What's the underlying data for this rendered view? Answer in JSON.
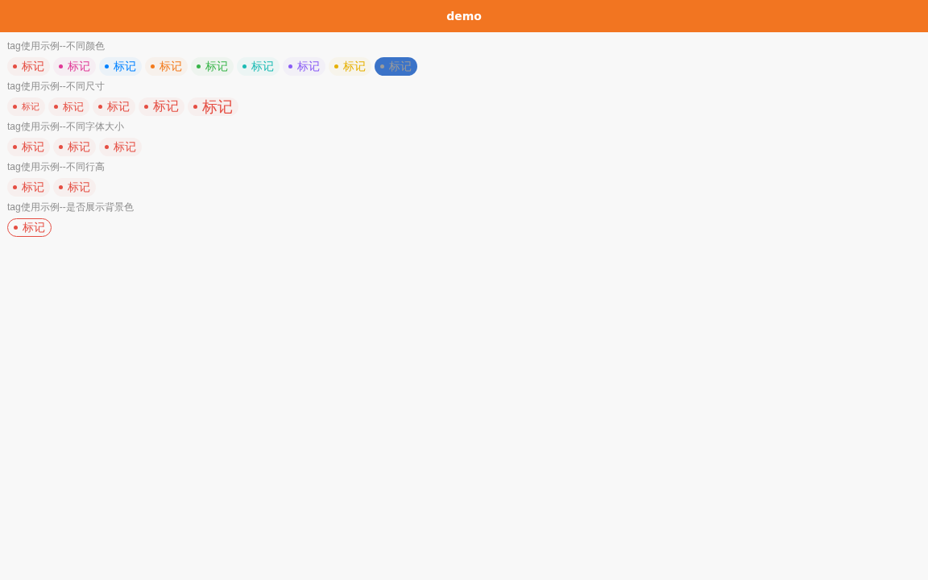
{
  "header": {
    "title": "demo"
  },
  "sections": [
    {
      "title": "tag使用示例--不同颜色",
      "kind": "colors",
      "tags": [
        {
          "text": "标记",
          "color": "#e54d42",
          "kind": "soft"
        },
        {
          "text": "标记",
          "color": "#e03997",
          "kind": "soft"
        },
        {
          "text": "标记",
          "color": "#0081ff",
          "kind": "soft"
        },
        {
          "text": "标记",
          "color": "#f37b1d",
          "kind": "soft"
        },
        {
          "text": "标记",
          "color": "#39b54a",
          "kind": "soft"
        },
        {
          "text": "标记",
          "color": "#1cbbb4",
          "kind": "soft"
        },
        {
          "text": "标记",
          "color": "#8a5cf5",
          "kind": "soft"
        },
        {
          "text": "标记",
          "color": "#e6b000",
          "kind": "soft"
        },
        {
          "text": "标记",
          "color": "#3b73c8",
          "kind": "solid"
        }
      ]
    },
    {
      "title": "tag使用示例--不同尺寸",
      "kind": "sizes",
      "tags": [
        {
          "text": "标记",
          "color": "#e54d42",
          "kind": "soft"
        },
        {
          "text": "标记",
          "color": "#e54d42",
          "kind": "soft"
        },
        {
          "text": "标记",
          "color": "#e54d42",
          "kind": "soft"
        },
        {
          "text": "标记",
          "color": "#e54d42",
          "kind": "soft"
        },
        {
          "text": "标记",
          "color": "#e54d42",
          "kind": "soft"
        }
      ]
    },
    {
      "title": "tag使用示例--不同字体大小",
      "kind": "plain",
      "tags": [
        {
          "text": "标记",
          "color": "#e54d42",
          "kind": "soft"
        },
        {
          "text": "标记",
          "color": "#e54d42",
          "kind": "soft"
        },
        {
          "text": "标记",
          "color": "#e54d42",
          "kind": "soft"
        }
      ]
    },
    {
      "title": "tag使用示例--不同行高",
      "kind": "plain",
      "tags": [
        {
          "text": "标记",
          "color": "#e54d42",
          "kind": "soft"
        },
        {
          "text": "标记",
          "color": "#e54d42",
          "kind": "soft"
        }
      ]
    },
    {
      "title": "tag使用示例--是否展示背景色",
      "kind": "plain",
      "tags": [
        {
          "text": "标记",
          "color": "#e54d42",
          "kind": "outline"
        }
      ]
    }
  ]
}
